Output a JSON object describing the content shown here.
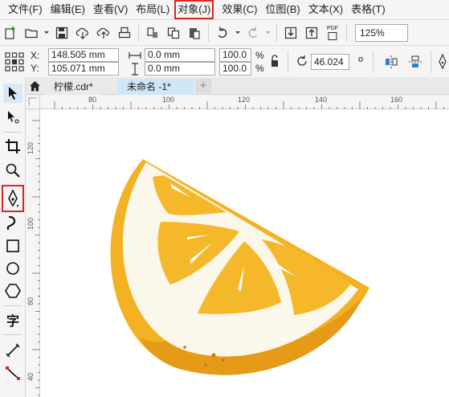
{
  "menu": [
    {
      "label": "文件(F)",
      "highlight": false
    },
    {
      "label": "编辑(E)",
      "highlight": false
    },
    {
      "label": "查看(V)",
      "highlight": false
    },
    {
      "label": "布局(L)",
      "highlight": false
    },
    {
      "label": "对象(J)",
      "highlight": true
    },
    {
      "label": "效果(C)",
      "highlight": false
    },
    {
      "label": "位图(B)",
      "highlight": false
    },
    {
      "label": "文本(X)",
      "highlight": false
    },
    {
      "label": "表格(T)",
      "highlight": false
    }
  ],
  "toolbar": {
    "pdf_label": "PDF",
    "zoom": "125%"
  },
  "propbar": {
    "x_label": "X:",
    "y_label": "Y:",
    "x_value": "148.505 mm",
    "y_value": "105.071 mm",
    "width_value": "0.0 mm",
    "height_value": "0.0 mm",
    "scale_x": "100.0",
    "scale_y": "100.0",
    "percent": "%",
    "rotation": "46.024",
    "degree": "o"
  },
  "tabs": {
    "items": [
      "柠檬.cdr*",
      "未命名 -1*"
    ],
    "active_index": 1,
    "add": "+"
  },
  "ruler": {
    "h_marks": [
      "80",
      "100",
      "120",
      "140",
      "160"
    ],
    "v_marks": [
      "120",
      "100",
      "80",
      "60",
      "40"
    ]
  },
  "tools": {
    "text_tool_label": "字",
    "active_tool": "pen-tool"
  },
  "colors": {
    "highlight": "#e02424",
    "lemon_yellow": "#f4b82a",
    "lemon_orange": "#e99e1c",
    "pith": "#fbf7ea",
    "active_tab": "#cfe6f7"
  }
}
